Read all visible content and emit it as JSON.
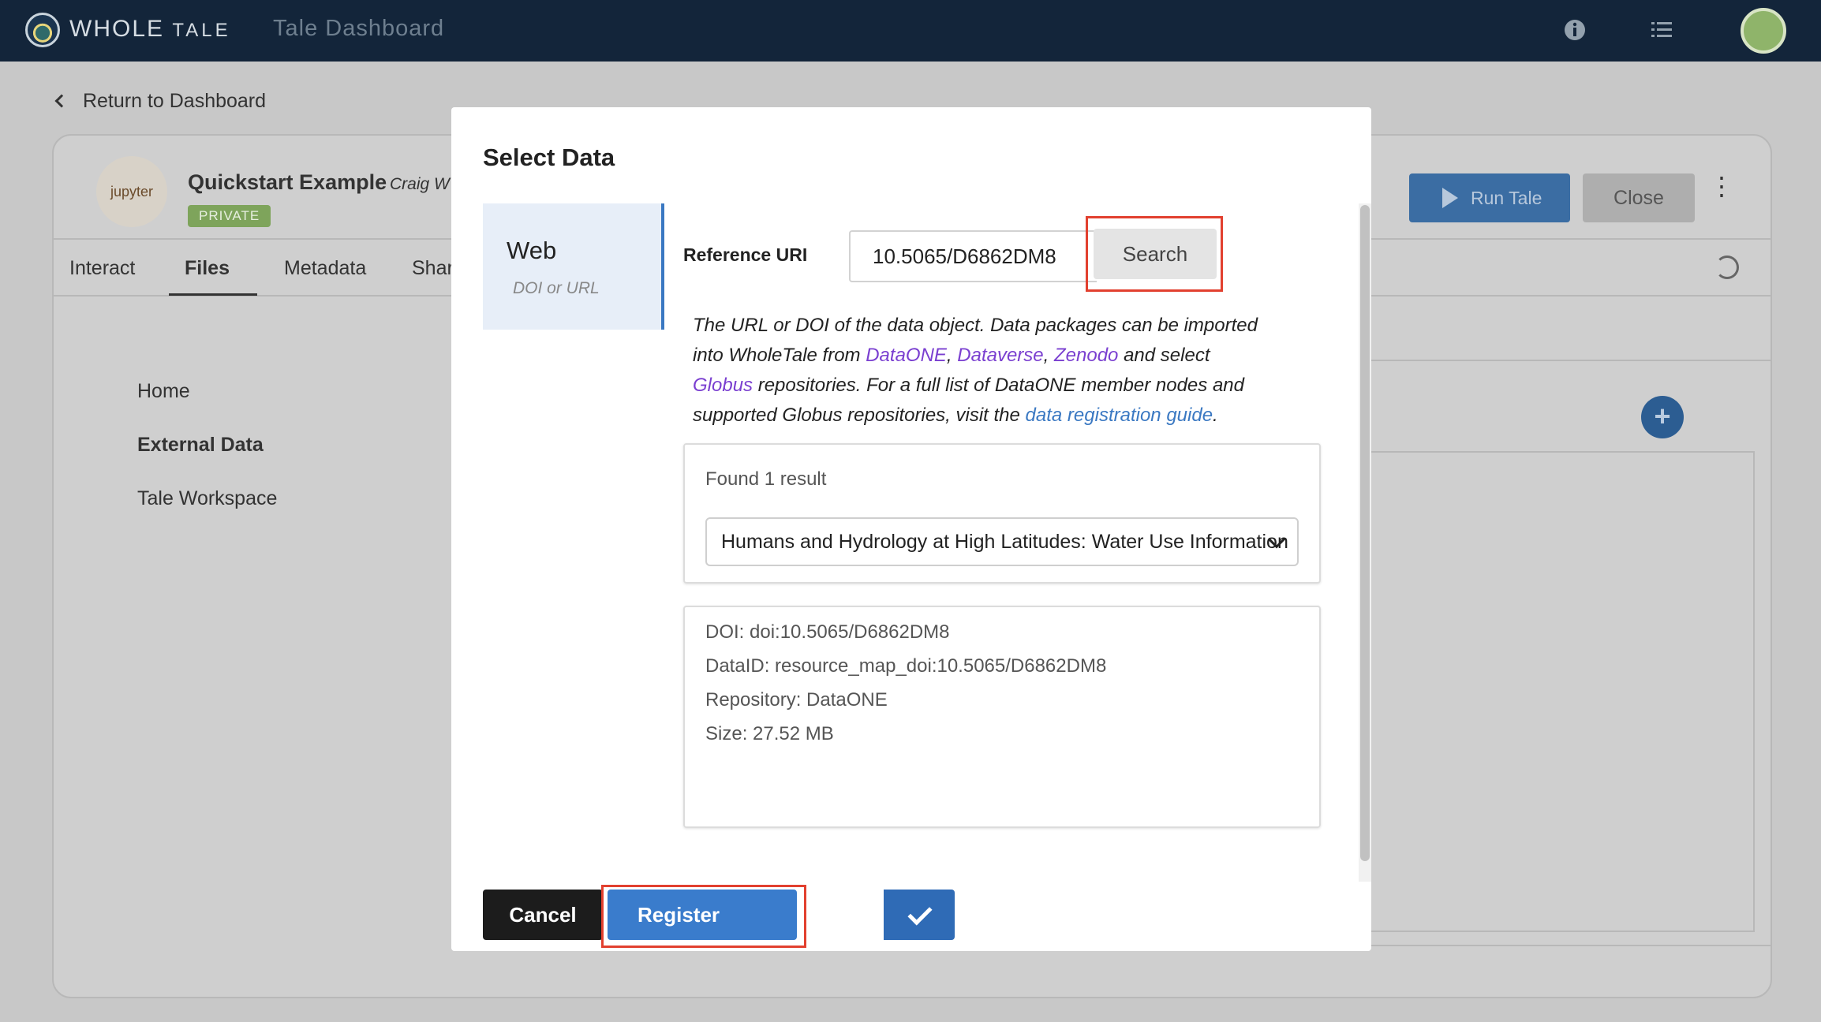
{
  "topbar": {
    "brand_whole": "WHOLE",
    "brand_tale": "TALE",
    "app_title": "Tale Dashboard"
  },
  "page": {
    "back_link": "Return to Dashboard",
    "tale": {
      "title": "Quickstart Example",
      "author": "Craig W",
      "badge": "PRIVATE",
      "logo_text": "jupyter"
    },
    "actions": {
      "run": "Run Tale",
      "close": "Close"
    },
    "tabs": [
      "Interact",
      "Files",
      "Metadata",
      "Shar"
    ],
    "active_tab": "Files",
    "sidebar": [
      "Home",
      "External Data",
      "Tale Workspace"
    ],
    "active_sidebar": "External Data"
  },
  "modal": {
    "title": "Select Data",
    "source": {
      "label": "Web",
      "sublabel": "DOI or URL"
    },
    "reference_label": "Reference URI",
    "reference_value": "10.5065/D6862DM8",
    "search_label": "Search",
    "description": {
      "part1": "The URL or DOI of the data object. Data packages can be imported into WholeTale from ",
      "link_dataone": "DataONE",
      "sep1": ", ",
      "link_dataverse": "Dataverse",
      "sep2": ", ",
      "link_zenodo": "Zenodo",
      "part2": " and select ",
      "link_globus": "Globus",
      "part3": " repositories. For a full list of DataONE member nodes and supported Globus repositories, visit the ",
      "link_guide": "data registration guide",
      "part4": "."
    },
    "found_text": "Found 1 result",
    "selected_result": "Humans and Hydrology at High Latitudes: Water Use Information",
    "details": {
      "doi": "DOI: doi:10.5065/D6862DM8",
      "data_id": "DataID: resource_map_doi:10.5065/D6862DM8",
      "repository": "Repository: DataONE",
      "size": "Size: 27.52 MB"
    },
    "cancel_label": "Cancel",
    "register_label": "Register"
  },
  "colors": {
    "topbar": "#13253a",
    "primary": "#3a7ccc",
    "highlight": "#e2402f",
    "link_purple": "#7a3fd0",
    "link_blue": "#3a78c2"
  },
  "icons": {
    "back": "chevron-left-icon",
    "info": "info-icon",
    "tasks": "task-list-icon",
    "run": "play-icon",
    "more": "kebab-icon",
    "history": "history-icon",
    "add": "plus-icon",
    "dropdown": "chevron-down-icon",
    "register": "check-icon"
  }
}
